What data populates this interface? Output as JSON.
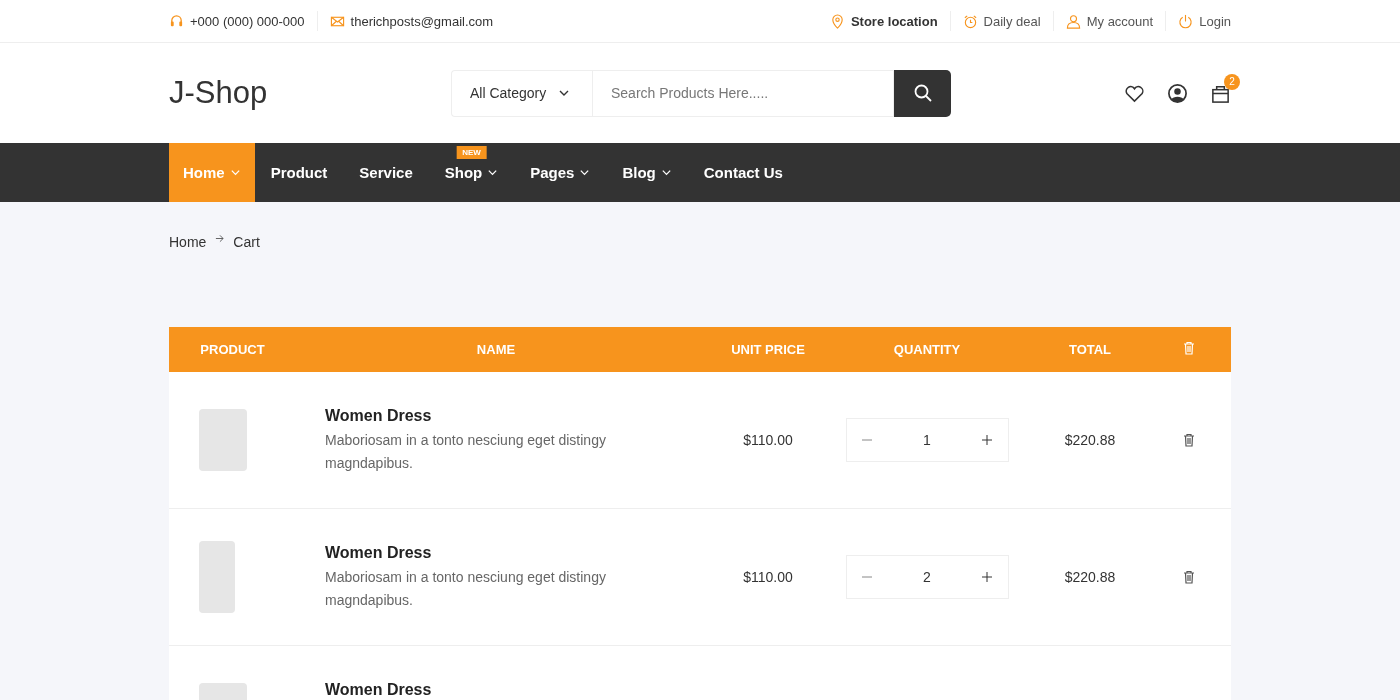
{
  "topbar": {
    "contacts": [
      {
        "text": "+000 (000) 000-000"
      },
      {
        "text": "therichposts@gmail.com"
      }
    ],
    "links": [
      {
        "label": "Store location",
        "selected": true
      },
      {
        "label": "Daily deal",
        "selected": false
      },
      {
        "label": "My account",
        "selected": false
      },
      {
        "label": "Login",
        "selected": false
      }
    ]
  },
  "header": {
    "logo": "J-Shop",
    "category": "All Category",
    "search": {
      "placeholder": "Search Products Here....."
    },
    "cart_count": "2"
  },
  "nav": [
    {
      "label": "Home",
      "selected": true,
      "dropdown": true
    },
    {
      "label": "Product",
      "selected": false,
      "dropdown": false
    },
    {
      "label": "Service",
      "selected": false,
      "dropdown": false
    },
    {
      "label": "Shop",
      "selected": false,
      "dropdown": true,
      "badge": "NEW"
    },
    {
      "label": "Pages",
      "selected": false,
      "dropdown": true
    },
    {
      "label": "Blog",
      "selected": false,
      "dropdown": true
    },
    {
      "label": "Contact Us",
      "selected": false,
      "dropdown": false
    }
  ],
  "breadcrumb": [
    "Home",
    "Cart"
  ],
  "table": {
    "columns": [
      "PRODUCT",
      "NAME",
      "UNIT PRICE",
      "QUANTITY",
      "TOTAL"
    ],
    "rows": [
      {
        "name": "Women Dress",
        "description": "Maboriosam in a tonto nesciung eget distingy magndapibus.",
        "unit_price": "$110.00",
        "quantity": "1",
        "total": "$220.88"
      },
      {
        "name": "Women Dress",
        "description": "Maboriosam in a tonto nesciung eget distingy magndapibus.",
        "unit_price": "$110.00",
        "quantity": "2",
        "total": "$220.88"
      },
      {
        "name": "Women Dress"
      }
    ]
  }
}
